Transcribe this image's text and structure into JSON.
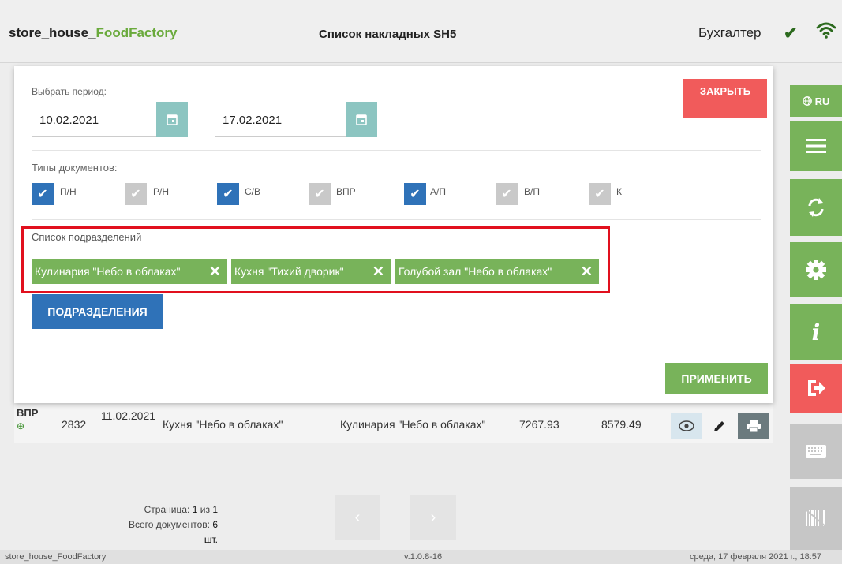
{
  "header": {
    "app_name_prefix": "store_house_",
    "app_name_accent": "FoodFactory",
    "page_title": "Список накладных SH5",
    "user_role": "Бухгалтер"
  },
  "modal": {
    "period_label": "Выбрать период:",
    "date_from": "10.02.2021",
    "date_to": "17.02.2021",
    "close_label": "ЗАКРЫТЬ",
    "doc_types_label": "Типы документов:",
    "doc_types": [
      {
        "label": "П/Н",
        "checked": true
      },
      {
        "label": "Р/Н",
        "checked": false
      },
      {
        "label": "С/В",
        "checked": true
      },
      {
        "label": "ВПР",
        "checked": false
      },
      {
        "label": "А/П",
        "checked": true
      },
      {
        "label": "В/П",
        "checked": false
      },
      {
        "label": "К",
        "checked": false
      }
    ],
    "departments_label": "Список подразделений",
    "departments": [
      "Кулинария \"Небо в облаках\"",
      "Кухня \"Тихий дворик\"",
      "Голубой зал \"Небо в облаках\""
    ],
    "departments_button": "ПОДРАЗДЕЛЕНИЯ",
    "apply_label": "ПРИМЕНИТЬ"
  },
  "table": {
    "rows": [
      {
        "type": "ВПР",
        "number": "2832",
        "date": "11.02.2021",
        "from": "Кухня \"Небо в облаках\"",
        "to": "Кулинария \"Небо в облаках\"",
        "sum1": "7267.93",
        "sum2": "8579.49"
      }
    ]
  },
  "pager": {
    "page_prefix": "Страница:",
    "page_current": "1",
    "page_of": "из",
    "page_total": "1",
    "docs_prefix": "Всего документов:",
    "docs_count": "6 шт."
  },
  "sidebar": {
    "lang_label": "RU"
  },
  "footer": {
    "left": "store_house_FoodFactory",
    "version": "v.1.0.8-16",
    "datetime": "среда, 17 февраля 2021 г., 18:57"
  },
  "colors": {
    "green": "#78b35a",
    "red": "#f15b5b",
    "blue": "#2f72b8",
    "teal": "#8cc5c1"
  }
}
